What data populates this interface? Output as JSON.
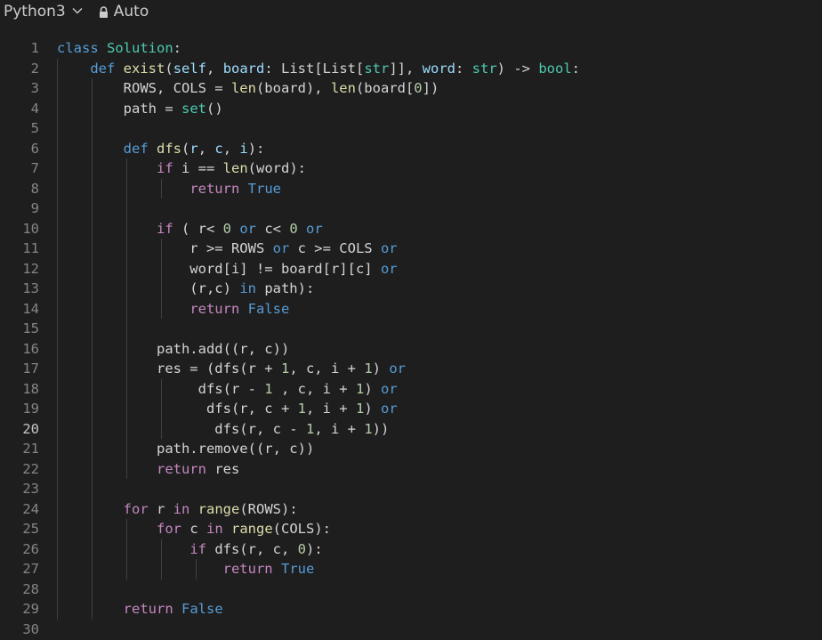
{
  "topbar": {
    "language": "Python3",
    "mode": "Auto"
  },
  "editor": {
    "active_line": 20,
    "lines": [
      {
        "n": "1",
        "guides": [],
        "tokens": [
          [
            "kw",
            "class"
          ],
          [
            "",
            " "
          ],
          [
            "cls",
            "Solution"
          ],
          [
            "",
            ":"
          ]
        ]
      },
      {
        "n": "2",
        "guides": [
          0
        ],
        "tokens": [
          [
            "",
            "    "
          ],
          [
            "kw",
            "def"
          ],
          [
            "",
            " "
          ],
          [
            "fn",
            "exist"
          ],
          [
            "",
            "("
          ],
          [
            "var",
            "self"
          ],
          [
            "",
            ", "
          ],
          [
            "var",
            "board"
          ],
          [
            "",
            ": List[List["
          ],
          [
            "cls",
            "str"
          ],
          [
            "",
            "]], "
          ],
          [
            "var",
            "word"
          ],
          [
            "",
            ": "
          ],
          [
            "cls",
            "str"
          ],
          [
            "",
            ") -> "
          ],
          [
            "cls",
            "bool"
          ],
          [
            "",
            ":"
          ]
        ]
      },
      {
        "n": "3",
        "guides": [
          0,
          1
        ],
        "tokens": [
          [
            "",
            "        ROWS, COLS = "
          ],
          [
            "fn",
            "len"
          ],
          [
            "",
            "(board), "
          ],
          [
            "fn",
            "len"
          ],
          [
            "",
            "(board["
          ],
          [
            "num",
            "0"
          ],
          [
            "",
            "])"
          ]
        ]
      },
      {
        "n": "4",
        "guides": [
          0,
          1
        ],
        "tokens": [
          [
            "",
            "        path = "
          ],
          [
            "cls",
            "set"
          ],
          [
            "",
            "()"
          ]
        ]
      },
      {
        "n": "5",
        "guides": [
          0,
          1
        ],
        "tokens": []
      },
      {
        "n": "6",
        "guides": [
          0,
          1
        ],
        "tokens": [
          [
            "",
            "        "
          ],
          [
            "kw",
            "def"
          ],
          [
            "",
            " "
          ],
          [
            "fn",
            "dfs"
          ],
          [
            "",
            "("
          ],
          [
            "var",
            "r"
          ],
          [
            "",
            ", "
          ],
          [
            "var",
            "c"
          ],
          [
            "",
            ", "
          ],
          [
            "var",
            "i"
          ],
          [
            "",
            "):"
          ]
        ]
      },
      {
        "n": "7",
        "guides": [
          0,
          1,
          2
        ],
        "tokens": [
          [
            "",
            "            "
          ],
          [
            "ctl",
            "if"
          ],
          [
            "",
            " i == "
          ],
          [
            "fn",
            "len"
          ],
          [
            "",
            "(word):"
          ]
        ]
      },
      {
        "n": "8",
        "guides": [
          0,
          1,
          2,
          3
        ],
        "tokens": [
          [
            "",
            "                "
          ],
          [
            "ctl",
            "return"
          ],
          [
            "",
            " "
          ],
          [
            "kw",
            "True"
          ]
        ]
      },
      {
        "n": "9",
        "guides": [
          0,
          1,
          2
        ],
        "tokens": []
      },
      {
        "n": "10",
        "guides": [
          0,
          1,
          2
        ],
        "tokens": [
          [
            "",
            "            "
          ],
          [
            "ctl",
            "if"
          ],
          [
            "",
            " ( r< "
          ],
          [
            "num",
            "0"
          ],
          [
            "",
            " "
          ],
          [
            "kw",
            "or"
          ],
          [
            "",
            " c< "
          ],
          [
            "num",
            "0"
          ],
          [
            "",
            " "
          ],
          [
            "kw",
            "or"
          ]
        ]
      },
      {
        "n": "11",
        "guides": [
          0,
          1,
          2,
          3
        ],
        "tokens": [
          [
            "",
            "                r >= ROWS "
          ],
          [
            "kw",
            "or"
          ],
          [
            "",
            " c >= COLS "
          ],
          [
            "kw",
            "or"
          ]
        ]
      },
      {
        "n": "12",
        "guides": [
          0,
          1,
          2,
          3
        ],
        "tokens": [
          [
            "",
            "                word[i] != board[r][c] "
          ],
          [
            "kw",
            "or"
          ]
        ]
      },
      {
        "n": "13",
        "guides": [
          0,
          1,
          2,
          3
        ],
        "tokens": [
          [
            "",
            "                (r,c) "
          ],
          [
            "kw",
            "in"
          ],
          [
            "",
            " path):"
          ]
        ]
      },
      {
        "n": "14",
        "guides": [
          0,
          1,
          2,
          3
        ],
        "tokens": [
          [
            "",
            "                "
          ],
          [
            "ctl",
            "return"
          ],
          [
            "",
            " "
          ],
          [
            "kw",
            "False"
          ]
        ]
      },
      {
        "n": "15",
        "guides": [
          0,
          1,
          2
        ],
        "tokens": []
      },
      {
        "n": "16",
        "guides": [
          0,
          1,
          2
        ],
        "tokens": [
          [
            "",
            "            path.add((r, c))"
          ]
        ]
      },
      {
        "n": "17",
        "guides": [
          0,
          1,
          2
        ],
        "tokens": [
          [
            "",
            "            res = (dfs(r + "
          ],
          [
            "num",
            "1"
          ],
          [
            "",
            ", c, i + "
          ],
          [
            "num",
            "1"
          ],
          [
            "",
            ") "
          ],
          [
            "kw",
            "or"
          ]
        ]
      },
      {
        "n": "18",
        "guides": [
          0,
          1,
          2,
          3
        ],
        "tokens": [
          [
            "",
            "                 dfs(r - "
          ],
          [
            "num",
            "1"
          ],
          [
            "",
            " , c, i + "
          ],
          [
            "num",
            "1"
          ],
          [
            "",
            ") "
          ],
          [
            "kw",
            "or"
          ]
        ]
      },
      {
        "n": "19",
        "guides": [
          0,
          1,
          2,
          3
        ],
        "tokens": [
          [
            "",
            "                  dfs(r, c + "
          ],
          [
            "num",
            "1"
          ],
          [
            "",
            ", i + "
          ],
          [
            "num",
            "1"
          ],
          [
            "",
            ") "
          ],
          [
            "kw",
            "or"
          ]
        ]
      },
      {
        "n": "20",
        "guides": [
          0,
          1,
          2,
          3
        ],
        "tokens": [
          [
            "",
            "                   dfs(r, c - "
          ],
          [
            "num",
            "1"
          ],
          [
            "",
            ", i + "
          ],
          [
            "num",
            "1"
          ],
          [
            "",
            "))"
          ]
        ]
      },
      {
        "n": "21",
        "guides": [
          0,
          1,
          2
        ],
        "tokens": [
          [
            "",
            "            path.remove((r, c))"
          ]
        ]
      },
      {
        "n": "22",
        "guides": [
          0,
          1,
          2
        ],
        "tokens": [
          [
            "",
            "            "
          ],
          [
            "ctl",
            "return"
          ],
          [
            "",
            " res"
          ]
        ]
      },
      {
        "n": "23",
        "guides": [
          0,
          1
        ],
        "tokens": []
      },
      {
        "n": "24",
        "guides": [
          0,
          1
        ],
        "tokens": [
          [
            "",
            "        "
          ],
          [
            "ctl",
            "for"
          ],
          [
            "",
            " r "
          ],
          [
            "ctl",
            "in"
          ],
          [
            "",
            " "
          ],
          [
            "fn",
            "range"
          ],
          [
            "",
            "(ROWS):"
          ]
        ]
      },
      {
        "n": "25",
        "guides": [
          0,
          1,
          2
        ],
        "tokens": [
          [
            "",
            "            "
          ],
          [
            "ctl",
            "for"
          ],
          [
            "",
            " c "
          ],
          [
            "ctl",
            "in"
          ],
          [
            "",
            " "
          ],
          [
            "fn",
            "range"
          ],
          [
            "",
            "(COLS):"
          ]
        ]
      },
      {
        "n": "26",
        "guides": [
          0,
          1,
          2,
          3
        ],
        "tokens": [
          [
            "",
            "                "
          ],
          [
            "ctl",
            "if"
          ],
          [
            "",
            " dfs(r, c, "
          ],
          [
            "num",
            "0"
          ],
          [
            "",
            "):"
          ]
        ]
      },
      {
        "n": "27",
        "guides": [
          0,
          1,
          2,
          3,
          4
        ],
        "tokens": [
          [
            "",
            "                    "
          ],
          [
            "ctl",
            "return"
          ],
          [
            "",
            " "
          ],
          [
            "kw",
            "True"
          ]
        ]
      },
      {
        "n": "28",
        "guides": [
          0,
          1
        ],
        "tokens": []
      },
      {
        "n": "29",
        "guides": [
          0,
          1
        ],
        "tokens": [
          [
            "",
            "        "
          ],
          [
            "ctl",
            "return"
          ],
          [
            "",
            " "
          ],
          [
            "kw",
            "False"
          ]
        ]
      },
      {
        "n": "30",
        "guides": [],
        "tokens": []
      }
    ]
  }
}
